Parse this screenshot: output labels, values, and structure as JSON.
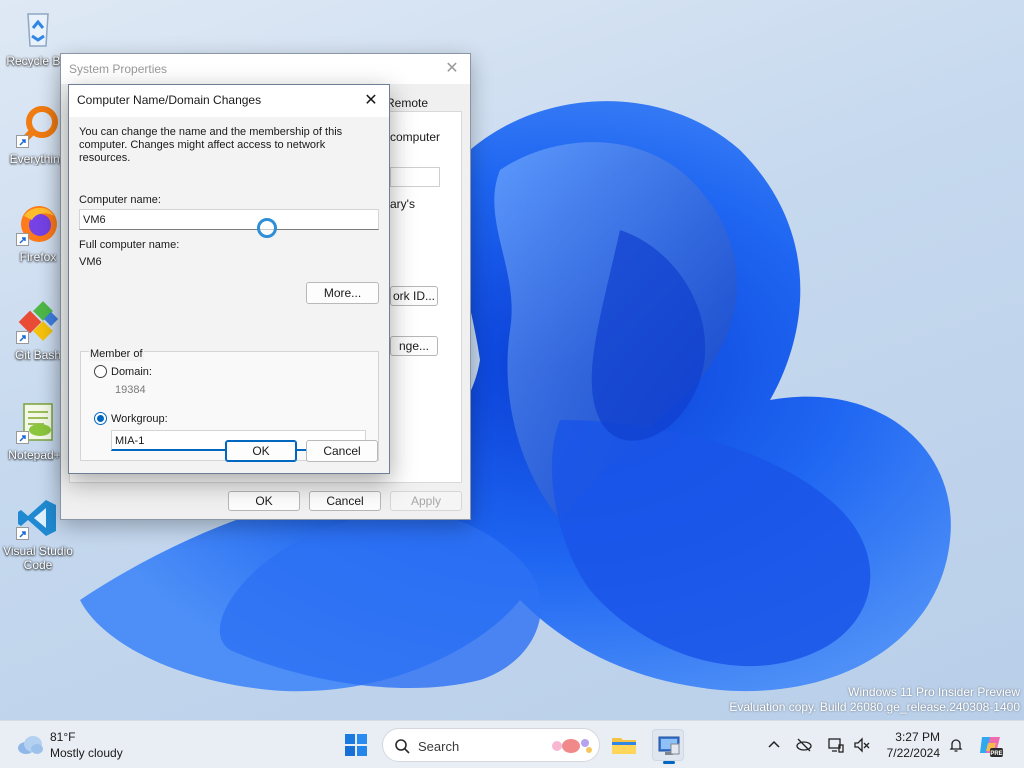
{
  "desktop": {
    "icons": [
      {
        "label": "Recycle Bin",
        "icon": "recycle-bin-icon"
      },
      {
        "label": "Everything",
        "icon": "everything-search-icon"
      },
      {
        "label": "Firefox",
        "icon": "firefox-icon"
      },
      {
        "label": "Git Bash",
        "icon": "git-bash-icon"
      },
      {
        "label": "Notepad++",
        "icon": "notepad-plus-plus-icon"
      },
      {
        "label": "Visual Studio Code",
        "icon": "vscode-icon"
      }
    ],
    "watermark": {
      "line1": "Windows 11 Pro Insider Preview",
      "line2": "Evaluation copy. Build 26080.ge_release.240308-1400"
    }
  },
  "system_properties": {
    "title": "System Properties",
    "visible_fragments": {
      "tab_remote": "Remote",
      "computer_text": "computer",
      "description_text": "ary's",
      "network_id_button": "ork ID...",
      "change_button": "nge..."
    },
    "buttons": {
      "ok": "OK",
      "cancel": "Cancel",
      "apply": "Apply"
    }
  },
  "dialog": {
    "title": "Computer Name/Domain Changes",
    "description": "You can change the name and the membership of this computer. Changes might affect access to network resources.",
    "computer_name_label": "Computer name:",
    "computer_name_value": "VM6",
    "full_name_label": "Full computer name:",
    "full_name_value": "VM6",
    "more_button": "More...",
    "member_of": {
      "legend": "Member of",
      "domain_label": "Domain:",
      "domain_value": "19384",
      "domain_selected": false,
      "workgroup_label": "Workgroup:",
      "workgroup_value": "MIA-1",
      "workgroup_selected": true
    },
    "buttons": {
      "ok": "OK",
      "cancel": "Cancel"
    }
  },
  "taskbar": {
    "weather": {
      "temp": "81°F",
      "condition": "Mostly cloudy"
    },
    "search_label": "Search",
    "clock": {
      "time": "3:27 PM",
      "date": "7/22/2024"
    },
    "colors": {
      "accent": "#0067c0"
    }
  }
}
